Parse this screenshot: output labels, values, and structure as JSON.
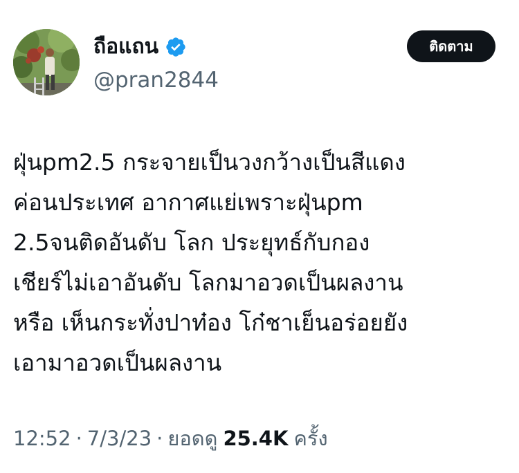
{
  "user": {
    "display_name": "ถือแถน",
    "handle": "@pran2844",
    "verified_icon": "verified-badge-icon",
    "verified_color": "#1d9bf0"
  },
  "follow_button": {
    "label": "ติดตาม"
  },
  "tweet": {
    "lines": [
      "ฝุ่นpm2.5 กระจายเป็นวงกว้างเป็นสีแดง",
      "ค่อนประเทศ อากาศแย่เพราะฝุ่นpm",
      "2.5จนติดอันดับ โลก ประยุทธ์กับกอง",
      "เชียร์ไม่เอาอันดับ โลกมาอวดเป็นผลงาน",
      "หรือ เห็นกระทั่งปาท๋อง โก๋ชาเย็นอร่อยยัง",
      "เอามาอวดเป็นผลงาน"
    ]
  },
  "meta": {
    "time": "12:52",
    "separator": "·",
    "date": "7/3/23",
    "views_label": "ยอดดู",
    "views_count": "25.4K",
    "views_unit": "ครั้ง"
  },
  "colors": {
    "text_primary": "#0f1419",
    "text_secondary": "#536471",
    "button_bg": "#0f1419",
    "button_text": "#ffffff"
  }
}
